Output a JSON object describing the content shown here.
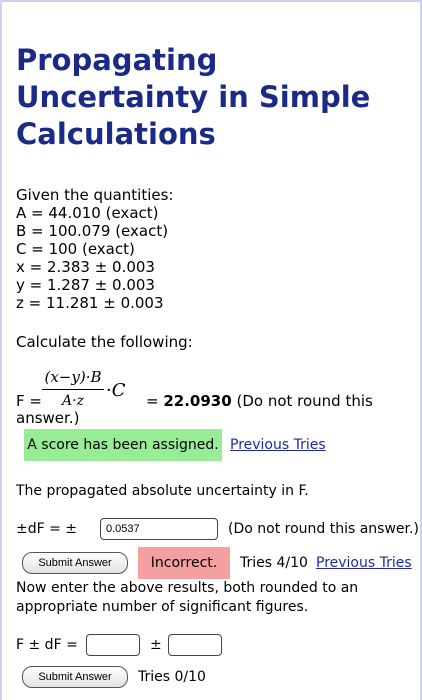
{
  "title": "Propagating Uncertainty in Simple Calculations",
  "given": {
    "header": "Given the quantities:",
    "lines": [
      "A = 44.010 (exact)",
      "B = 100.079 (exact)",
      "C = 100 (exact)",
      "x = 2.383 ± 0.003",
      "y = 1.287 ± 0.003",
      "z = 11.281 ± 0.003"
    ]
  },
  "calculate_header": "Calculate the following:",
  "formula": {
    "lead": "F =",
    "numerator": "(x−y)·B",
    "denominator": "A·z",
    "times_c": "·C",
    "equals": "=",
    "value": "22.0930",
    "note": "(Do not round this",
    "note_cont": "answer.)"
  },
  "score_badge": "A score has been assigned.",
  "previous_tries_link": "Previous Tries",
  "propagated_text": "The propagated absolute uncertainty in F.",
  "df": {
    "label": "±dF = ±",
    "input_value": "0.0537",
    "note": "(Do not round this answer.)"
  },
  "submit1": {
    "button": "Submit Answer",
    "status": "Incorrect.",
    "tries": "Tries 4/10",
    "link": "Previous Tries"
  },
  "instructions": "Now enter the above results, both rounded to an appropriate number of significant figures.",
  "final": {
    "label": "F ± dF =",
    "pm": "±",
    "input1_value": "",
    "input2_value": ""
  },
  "submit2": {
    "button": "Submit Answer",
    "tries": "Tries 0/10"
  },
  "colors": {
    "title": "#1a2a86",
    "score_green": "#98ec95",
    "incorrect_red": "#f4a0a0",
    "link_blue": "#1f2aa0",
    "frame_border": "#cfd3f2"
  }
}
